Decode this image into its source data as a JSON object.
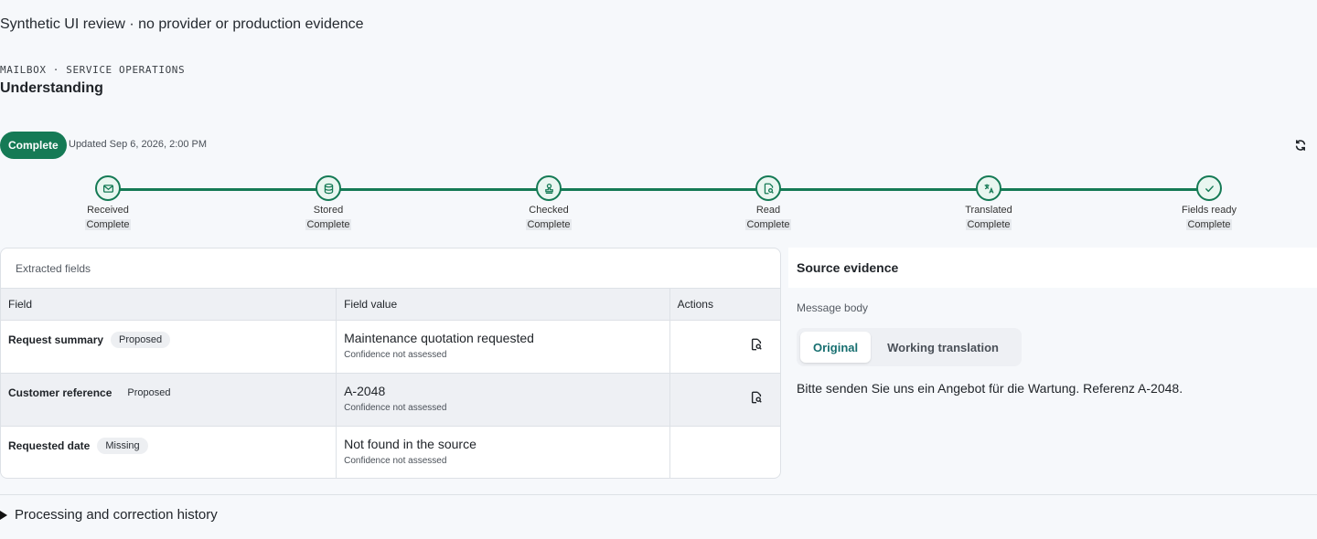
{
  "banner": "Synthetic UI review · no provider or production evidence",
  "header": {
    "eyebrow": "MAILBOX · SERVICE OPERATIONS",
    "title": "Understanding"
  },
  "status": {
    "badge": "Complete",
    "updated": "Updated Sep 6, 2026, 2:00 PM",
    "refresh_icon": "refresh-icon"
  },
  "steps": [
    {
      "label": "Received",
      "state": "Complete",
      "icon": "mail-icon"
    },
    {
      "label": "Stored",
      "state": "Complete",
      "icon": "database-icon"
    },
    {
      "label": "Checked",
      "state": "Complete",
      "icon": "stamp-icon"
    },
    {
      "label": "Read",
      "state": "Complete",
      "icon": "document-search-icon"
    },
    {
      "label": "Translated",
      "state": "Complete",
      "icon": "translate-icon"
    },
    {
      "label": "Fields ready",
      "state": "Complete",
      "icon": "check-icon"
    }
  ],
  "fields": {
    "caption": "Extracted fields",
    "columns": [
      "Field",
      "Field value",
      "Actions"
    ],
    "rows": [
      {
        "name": "Request summary",
        "status": "Proposed",
        "value": "Maintenance quotation requested",
        "confidence": "Confidence not assessed",
        "has_action": true
      },
      {
        "name": "Customer reference",
        "status": "Proposed",
        "value": "A-2048",
        "confidence": "Confidence not assessed",
        "has_action": true
      },
      {
        "name": "Requested date",
        "status": "Missing",
        "value": "Not found in the source",
        "confidence": "Confidence not assessed",
        "has_action": false
      }
    ]
  },
  "evidence": {
    "title": "Source evidence",
    "subtitle": "Message body",
    "tabs": [
      {
        "label": "Original",
        "active": true
      },
      {
        "label": "Working translation",
        "active": false
      }
    ],
    "body": "Bitte senden Sie uns ein Angebot für die Wartung. Referenz A-2048."
  },
  "history": {
    "label": "Processing and correction history"
  },
  "colors": {
    "accent": "#157a55",
    "tab_active_text": "#176f70"
  }
}
